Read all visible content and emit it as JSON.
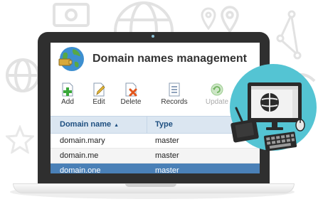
{
  "app": {
    "title": "Domain names management"
  },
  "toolbar": {
    "buttons": [
      {
        "label": "Add",
        "icon": "add-icon"
      },
      {
        "label": "Edit",
        "icon": "edit-icon"
      },
      {
        "label": "Delete",
        "icon": "delete-icon"
      },
      {
        "label": "Records",
        "icon": "records-icon"
      },
      {
        "label": "Update",
        "icon": "update-icon",
        "disabled": true
      }
    ]
  },
  "grid": {
    "columns": [
      "Domain name",
      "Type"
    ],
    "sorted_column": "Domain name",
    "sort_direction": "ascending",
    "rows": [
      {
        "name": "domain.mary",
        "type": "master"
      },
      {
        "name": "domain.me",
        "type": "master"
      },
      {
        "name": "domain.one",
        "type": "master",
        "selected": true
      }
    ]
  },
  "colors": {
    "header_bg": "#dbe6f1",
    "header_text": "#1e4f80",
    "selection": "#4a80b7",
    "accent_circle": "#54c4d3",
    "laptop_frame": "#2f2f2f"
  }
}
